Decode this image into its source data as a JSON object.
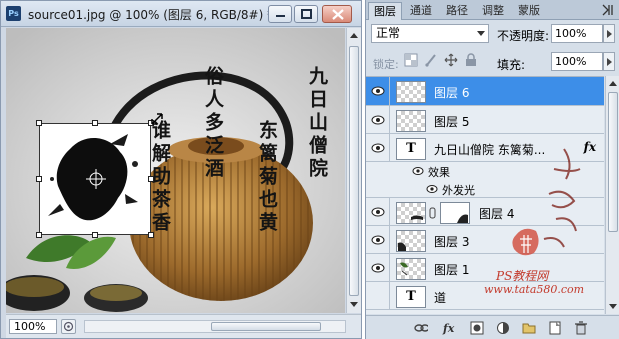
{
  "document": {
    "title": "source01.jpg @ 100% (图层 6, RGB/8#) *",
    "app_icon": "Ps",
    "zoom": "100%"
  },
  "poem": {
    "col1": "九日山僧院",
    "col2": "东篱菊也黄",
    "col3": "俗人多泛酒",
    "col4": "谁解助茶香"
  },
  "panel": {
    "tabs": [
      "图层",
      "通道",
      "路径",
      "调整",
      "蒙版"
    ],
    "blend_mode": "正常",
    "opacity_label": "不透明度:",
    "opacity_value": "100%",
    "lock_label": "锁定:",
    "fill_label": "填充:",
    "fill_value": "100%",
    "layers": {
      "l6": "图层 6",
      "l5": "图层 5",
      "text_layer": "九日山僧院    东篱菊...",
      "effects": "效果",
      "outer_glow": "外发光",
      "l4": "图层 4",
      "l3": "图层 3",
      "l1": "图层 1",
      "bg": "道"
    },
    "fx": "fx"
  },
  "watermark": {
    "line1": "PS教程网",
    "line2": "www.tata580.com"
  },
  "colors": {
    "selected_row": "#3d8ee8",
    "watermark_red": "#c33a2c"
  }
}
